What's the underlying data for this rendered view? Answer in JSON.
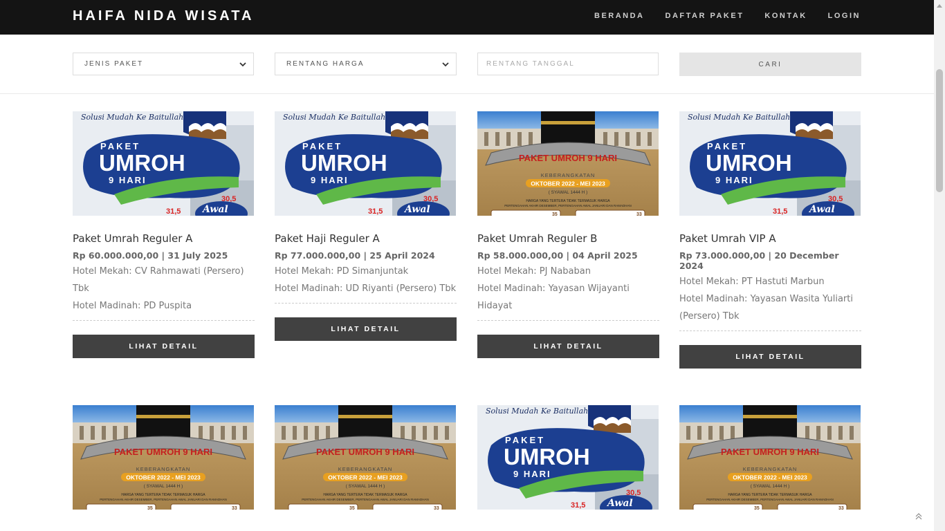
{
  "brand": "HAIFA NIDA WISATA",
  "nav": [
    "BERANDA",
    "DAFTAR PAKET",
    "KONTAK",
    "LOGIN"
  ],
  "filters": {
    "jenis_paket": "JENIS PAKET",
    "rentang_harga": "RENTANG HARGA",
    "rentang_tanggal_placeholder": "RENTANG TANGGAL",
    "cari_label": "CARI"
  },
  "colors": {
    "navbar": "#141414",
    "button_dark": "#414141",
    "accent_blue": "#1c3f91",
    "accent_gold": "#e8a020"
  },
  "detail_label": "LIHAT DETAIL",
  "cards": [
    {
      "title": "Paket Umrah Reguler A",
      "price_date": "Rp 60.000.000,00 | 31 July 2025",
      "hotel_mekah": "Hotel Mekah: CV Rahmawati (Persero) Tbk",
      "hotel_madinah": "Hotel Madinah: PD Puspita",
      "banner": "umroh-blue"
    },
    {
      "title": "Paket Haji Reguler A",
      "price_date": "Rp 77.000.000,00 | 25 April 2024",
      "hotel_mekah": "Hotel Mekah: PD Simanjuntak",
      "hotel_madinah": "Hotel Madinah: UD Riyanti (Persero) Tbk",
      "banner": "umroh-blue"
    },
    {
      "title": "Paket Umrah Reguler B",
      "price_date": "Rp 58.000.000,00 | 04 April 2025",
      "hotel_mekah": "Hotel Mekah: PJ Nababan",
      "hotel_madinah": "Hotel Madinah: Yayasan Wijayanti Hidayat",
      "banner": "kaaba"
    },
    {
      "title": "Paket Umrah VIP A",
      "price_date": "Rp 73.000.000,00 | 20 December 2024",
      "hotel_mekah": "Hotel Mekah: PT Hastuti Marbun",
      "hotel_madinah": "Hotel Madinah: Yayasan Wasita Yuliarti (Persero) Tbk",
      "banner": "umroh-blue"
    }
  ],
  "banner_text": {
    "tagline": "Solusi Mudah Ke Baitullah",
    "paket": "PAKET",
    "umroh": "UMROH",
    "hari": "9 HARI",
    "price1": "31,5",
    "price2": "30,5",
    "awal": "Awal",
    "ribbon": "PAKET UMROH 9 HARI",
    "keberangkatan": "KEBERANGKATAN",
    "periode": "OKTOBER 2022 - MEI 2023",
    "syawal": "( SYAWAL 1444 H )",
    "note1": "HARGA YANG TERTERA TIDAK TERMASUK HARGA",
    "note2": "PERTENGAHAN AKHIR DESEMBER, PERTENGAHAN AWAL JANUARI DAN RAMADHAN",
    "num1": "35",
    "num2": "33"
  },
  "second_row_banners": [
    "kaaba",
    "kaaba",
    "umroh-blue",
    "kaaba"
  ]
}
